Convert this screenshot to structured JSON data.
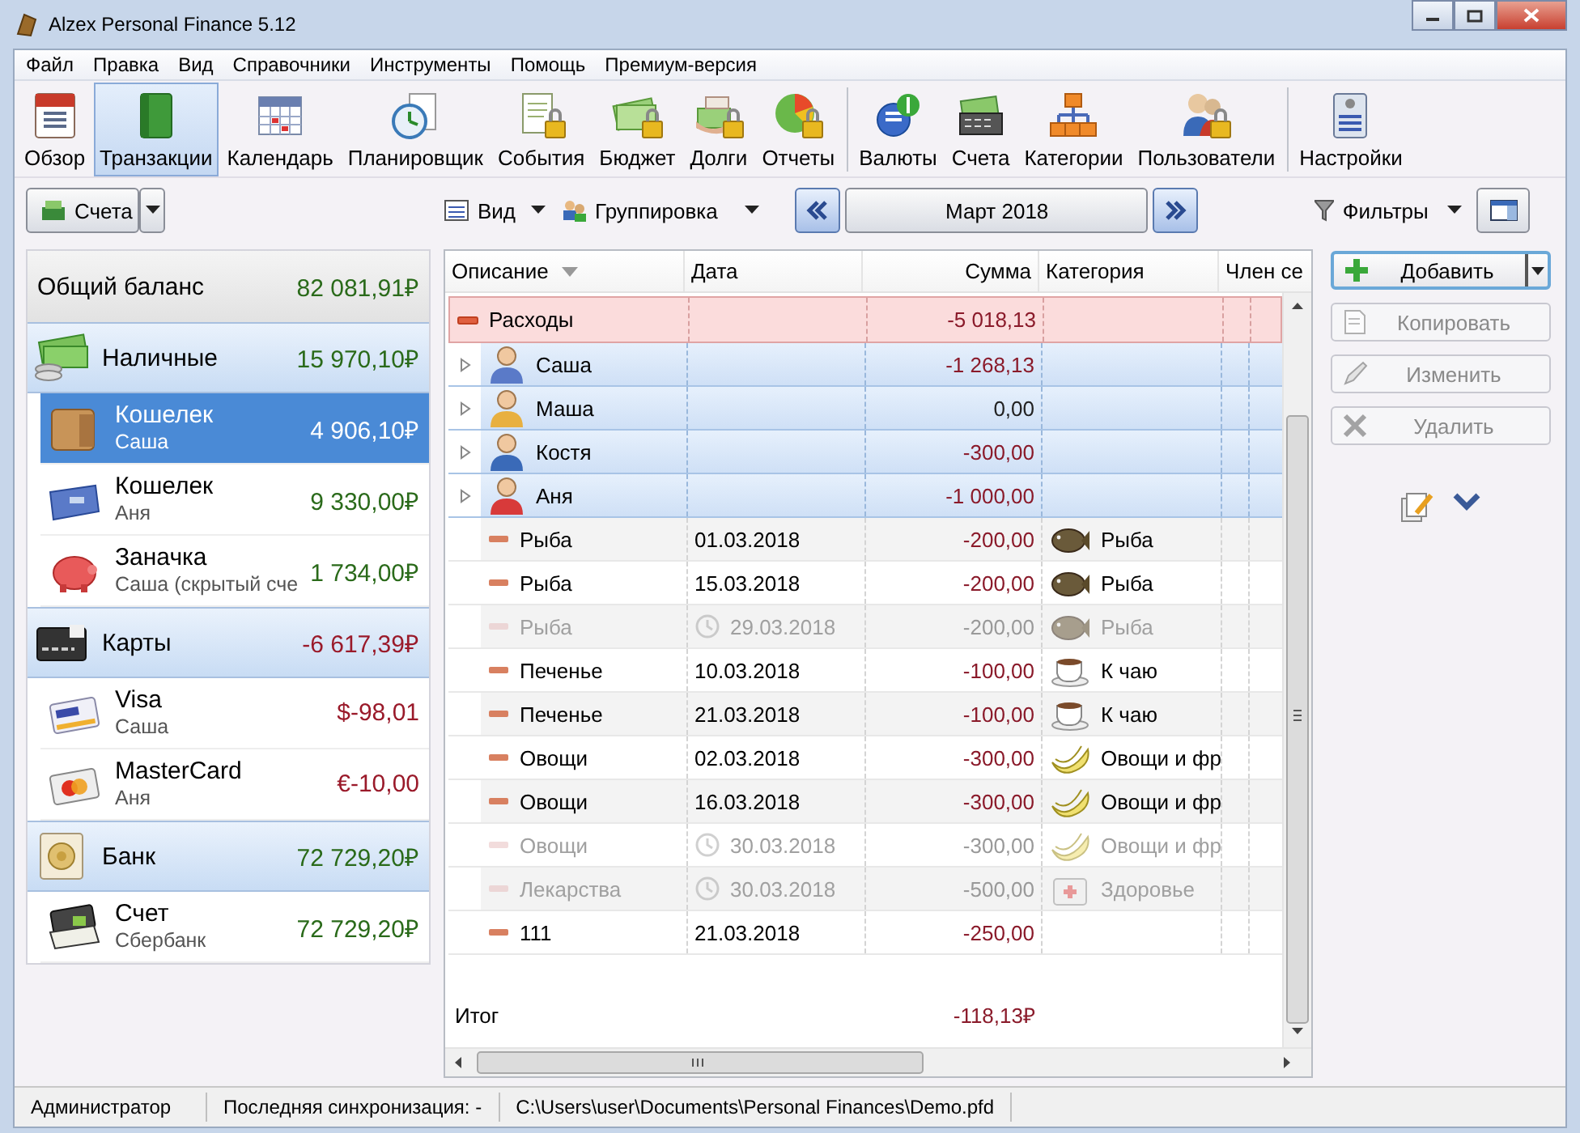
{
  "window": {
    "title": "Alzex Personal Finance 5.12"
  },
  "menu": [
    "Файл",
    "Правка",
    "Вид",
    "Справочники",
    "Инструменты",
    "Помощь",
    "Премиум-версия"
  ],
  "toolbar": [
    [
      {
        "label": "Обзор",
        "selected": false
      },
      {
        "label": "Транзакции",
        "selected": true
      },
      {
        "label": "Календарь",
        "selected": false
      },
      {
        "label": "Планировщик",
        "selected": false
      },
      {
        "label": "События",
        "selected": false
      },
      {
        "label": "Бюджет",
        "selected": false
      },
      {
        "label": "Долги",
        "selected": false
      },
      {
        "label": "Отчеты",
        "selected": false
      }
    ],
    [
      {
        "label": "Валюты",
        "selected": false
      },
      {
        "label": "Счета",
        "selected": false
      },
      {
        "label": "Категории",
        "selected": false
      },
      {
        "label": "Пользователи",
        "selected": false
      }
    ],
    [
      {
        "label": "Настройки",
        "selected": false
      }
    ]
  ],
  "subbar": {
    "accounts_button": "Счета",
    "view": "Вид",
    "grouping": "Группировка",
    "period": "Март 2018",
    "filters": "Фильтры"
  },
  "accounts": {
    "total": {
      "label": "Общий баланс",
      "amount": "82 081,91₽",
      "negative": false
    },
    "groups": [
      {
        "name": "Наличные",
        "amount": "15 970,10₽",
        "negative": false,
        "items": [
          {
            "name": "Кошелек",
            "owner": "Саша",
            "amount": "4 906,10₽",
            "negative": false,
            "selected": true
          },
          {
            "name": "Кошелек",
            "owner": "Аня",
            "amount": "9 330,00₽",
            "negative": false,
            "selected": false
          },
          {
            "name": "Заначка",
            "owner": "Саша (скрытый сче",
            "amount": "1 734,00₽",
            "negative": false,
            "selected": false
          }
        ]
      },
      {
        "name": "Карты",
        "amount": "-6 617,39₽",
        "negative": true,
        "items": [
          {
            "name": "Visa",
            "owner": "Саша",
            "amount": "$-98,01",
            "negative": true,
            "selected": false
          },
          {
            "name": "MasterCard",
            "owner": "Аня",
            "amount": "€-10,00",
            "negative": true,
            "selected": false
          }
        ]
      },
      {
        "name": "Банк",
        "amount": "72 729,20₽",
        "negative": false,
        "items": [
          {
            "name": "Счет",
            "owner": "Сбербанк",
            "amount": "72 729,20₽",
            "negative": false,
            "selected": false
          }
        ]
      }
    ]
  },
  "table": {
    "columns": [
      {
        "label": "Описание",
        "sorted": true
      },
      {
        "label": "Дата",
        "sorted": false
      },
      {
        "label": "Сумма",
        "sorted": false
      },
      {
        "label": "Категория",
        "sorted": false
      },
      {
        "label": "Член се",
        "sorted": false
      }
    ],
    "rows": [
      {
        "kind": "group",
        "description": "Расходы",
        "amount": "-5 018,13",
        "negative": true,
        "expanded": true
      },
      {
        "kind": "person",
        "description": "Саша",
        "amount": "-1 268,13",
        "negative": true,
        "expanded": false
      },
      {
        "kind": "person",
        "description": "Маша",
        "amount": "0,00",
        "negative": false,
        "expanded": false
      },
      {
        "kind": "person",
        "description": "Костя",
        "amount": "-300,00",
        "negative": true,
        "expanded": false
      },
      {
        "kind": "person",
        "description": "Аня",
        "amount": "-1 000,00",
        "negative": true,
        "expanded": false
      },
      {
        "kind": "transaction",
        "description": "Рыба",
        "date": "01.03.2018",
        "amount": "-200,00",
        "negative": true,
        "category": "Рыба",
        "planned": false
      },
      {
        "kind": "transaction",
        "description": "Рыба",
        "date": "15.03.2018",
        "amount": "-200,00",
        "negative": true,
        "category": "Рыба",
        "planned": false
      },
      {
        "kind": "transaction",
        "description": "Рыба",
        "date": "29.03.2018",
        "amount": "-200,00",
        "negative": true,
        "category": "Рыба",
        "planned": true
      },
      {
        "kind": "transaction",
        "description": "Печенье",
        "date": "10.03.2018",
        "amount": "-100,00",
        "negative": true,
        "category": "К чаю",
        "planned": false
      },
      {
        "kind": "transaction",
        "description": "Печенье",
        "date": "21.03.2018",
        "amount": "-100,00",
        "negative": true,
        "category": "К чаю",
        "planned": false
      },
      {
        "kind": "transaction",
        "description": "Овощи",
        "date": "02.03.2018",
        "amount": "-300,00",
        "negative": true,
        "category": "Овощи и фр",
        "planned": false
      },
      {
        "kind": "transaction",
        "description": "Овощи",
        "date": "16.03.2018",
        "amount": "-300,00",
        "negative": true,
        "category": "Овощи и фр",
        "planned": false
      },
      {
        "kind": "transaction",
        "description": "Овощи",
        "date": "30.03.2018",
        "amount": "-300,00",
        "negative": true,
        "category": "Овощи и фр",
        "planned": true
      },
      {
        "kind": "transaction",
        "description": "Лекарства",
        "date": "30.03.2018",
        "amount": "-500,00",
        "negative": true,
        "category": "Здоровье",
        "planned": true
      },
      {
        "kind": "transaction",
        "description": "111",
        "date": "21.03.2018",
        "amount": "-250,00",
        "negative": true,
        "planned": false
      }
    ],
    "total": {
      "label": "Итог",
      "amount": "-118,13₽",
      "negative": true
    }
  },
  "actions": [
    {
      "label": "Добавить",
      "disabled": false
    },
    {
      "label": "Копировать",
      "disabled": true
    },
    {
      "label": "Изменить",
      "disabled": true
    },
    {
      "label": "Удалить",
      "disabled": true
    }
  ],
  "status_bar": {
    "user": "Администратор",
    "sync": "Последняя синхронизация: -",
    "path": "C:\\Users\\user\\Documents\\Personal Finances\\Demo.pfd"
  }
}
